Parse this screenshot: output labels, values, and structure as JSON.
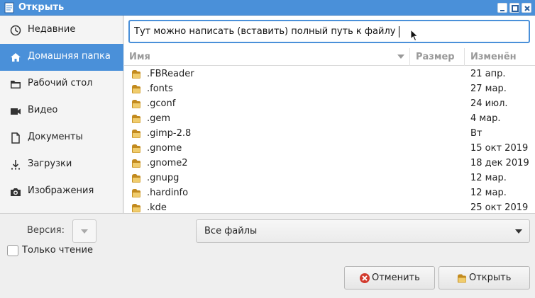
{
  "window": {
    "title": "Открыть"
  },
  "sidebar": {
    "items": [
      {
        "label": "Недавние",
        "icon": "clock-icon"
      },
      {
        "label": "Домашняя папка",
        "icon": "home-icon"
      },
      {
        "label": "Рабочий стол",
        "icon": "folder-icon"
      },
      {
        "label": "Видео",
        "icon": "video-icon"
      },
      {
        "label": "Документы",
        "icon": "document-icon"
      },
      {
        "label": "Загрузки",
        "icon": "download-icon"
      },
      {
        "label": "Изображения",
        "icon": "camera-icon"
      }
    ],
    "selected": "Домашняя папка"
  },
  "location": {
    "value": "Тут можно написать (вставить) полный путь к файлу"
  },
  "columns": {
    "name": "Имя",
    "size": "Размер",
    "modified": "Изменён"
  },
  "files": [
    {
      "name": ".FBReader",
      "modified": "21 апр."
    },
    {
      "name": ".fonts",
      "modified": "27 мар."
    },
    {
      "name": ".gconf",
      "modified": "24 июл."
    },
    {
      "name": ".gem",
      "modified": "4 мар."
    },
    {
      "name": ".gimp-2.8",
      "modified": "Вт"
    },
    {
      "name": ".gnome",
      "modified": "15 окт 2019"
    },
    {
      "name": ".gnome2",
      "modified": "18 дек 2019"
    },
    {
      "name": ".gnupg",
      "modified": "12 мар."
    },
    {
      "name": ".hardinfo",
      "modified": "12 мар."
    },
    {
      "name": ".kde",
      "modified": "25 окт 2019"
    }
  ],
  "version": {
    "label": "Версия:"
  },
  "filter": {
    "value": "Все файлы"
  },
  "readonly": {
    "label": "Только чтение",
    "checked": false
  },
  "buttons": {
    "cancel": "Отменить",
    "open": "Открыть"
  },
  "colors": {
    "accent": "#4a90d9",
    "folder": "#d9a93a",
    "cancel": "#d23b2e"
  }
}
